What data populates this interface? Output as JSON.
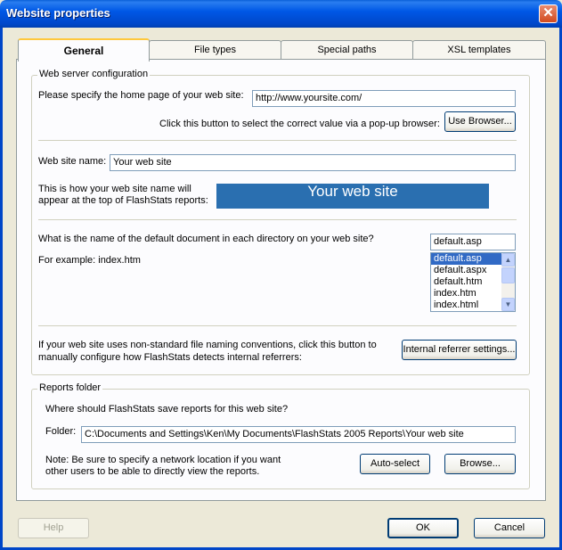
{
  "window": {
    "title": "Website properties",
    "close_glyph": "✕"
  },
  "tabs": [
    {
      "label": "General",
      "active": true
    },
    {
      "label": "File types",
      "active": false
    },
    {
      "label": "Special paths",
      "active": false
    },
    {
      "label": "XSL templates",
      "active": false
    }
  ],
  "web_server": {
    "group_label": "Web server configuration",
    "home_label": "Please specify the home page of your web site:",
    "home_value": "http://www.yoursite.com/",
    "browser_hint": "Click this button to select the correct value via a pop-up browser:",
    "use_browser_label": "Use Browser...",
    "site_name_label": "Web site name:",
    "site_name_value": "Your web site",
    "preview_line1": "This is how your web site name will",
    "preview_line2": "appear at the top of FlashStats reports:",
    "banner_text": "Your web site",
    "default_doc_label": "What is the name of the default document in each directory on your web site?",
    "default_doc_value": "default.asp",
    "example_label": "For example:  index.htm",
    "default_doc_options": [
      "default.asp",
      "default.aspx",
      "default.htm",
      "index.htm",
      "index.html"
    ],
    "referrer_line1": "If your web site uses non-standard file naming conventions, click this button to",
    "referrer_line2": "manually configure how FlashStats detects internal referrers:",
    "referrer_button": "Internal referrer settings..."
  },
  "reports": {
    "group_label": "Reports folder",
    "question": "Where should FlashStats save reports for this web site?",
    "folder_label": "Folder:",
    "folder_value": "C:\\Documents and Settings\\Ken\\My Documents\\FlashStats 2005 Reports\\Your web site",
    "note_line1": "Note:  Be sure to specify a network location if you want",
    "note_line2": "other users to be able to directly view the reports.",
    "auto_select_label": "Auto-select",
    "browse_label": "Browse..."
  },
  "footer": {
    "help_label": "Help",
    "ok_label": "OK",
    "cancel_label": "Cancel"
  },
  "colors": {
    "title_bar": "#0058e6",
    "banner": "#2a6fb0",
    "selection": "#316ac5",
    "dialog_bg": "#ece9d8"
  }
}
